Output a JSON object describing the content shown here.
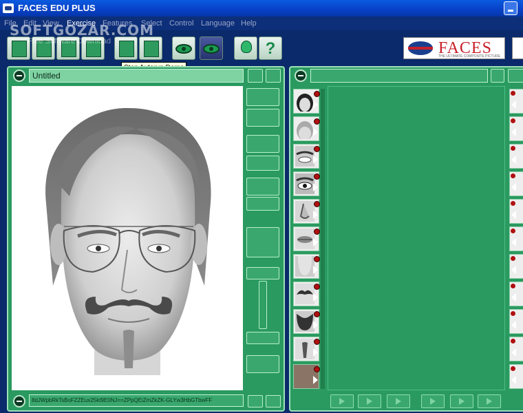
{
  "window": {
    "title": "FACES EDU PLUS"
  },
  "menu": {
    "items": [
      "File",
      "Edit",
      "View",
      "Exercise",
      "Features",
      "Select",
      "Control",
      "Language",
      "Help"
    ],
    "active": "Exercise"
  },
  "watermark": {
    "main": "SOFTGOZAR.COM",
    "sub": "Free Software Download"
  },
  "toolbar": {
    "tooltip": "Stop Autorun Demo",
    "buttons": [
      "new-composite-icon",
      "open-icon",
      "save-icon",
      "export-icon",
      "suspect-icon",
      "play-demo-icon",
      "eye-icon",
      "eye-dark-icon",
      "bulb-icon",
      "help-icon"
    ]
  },
  "logo": {
    "wordmark": "FACES",
    "tagline": "THE ULTIMATE COMPOSITE PICTURE"
  },
  "left_panel": {
    "name": "Untitled",
    "code": "8dJWpbRkTsBoFZZEux25kt9E0NJ==ZPpQEiZmZkZK-GLYw3HbGTbwFF"
  },
  "colors": {
    "panel": "#2a9a60",
    "accent": "#9fe0b8",
    "window": "#0a2a6b"
  },
  "features": [
    "head-shape",
    "hair",
    "eyebrows",
    "eyes",
    "nose",
    "lips",
    "chin",
    "moustache",
    "beard",
    "goatee",
    "skin-tone"
  ]
}
